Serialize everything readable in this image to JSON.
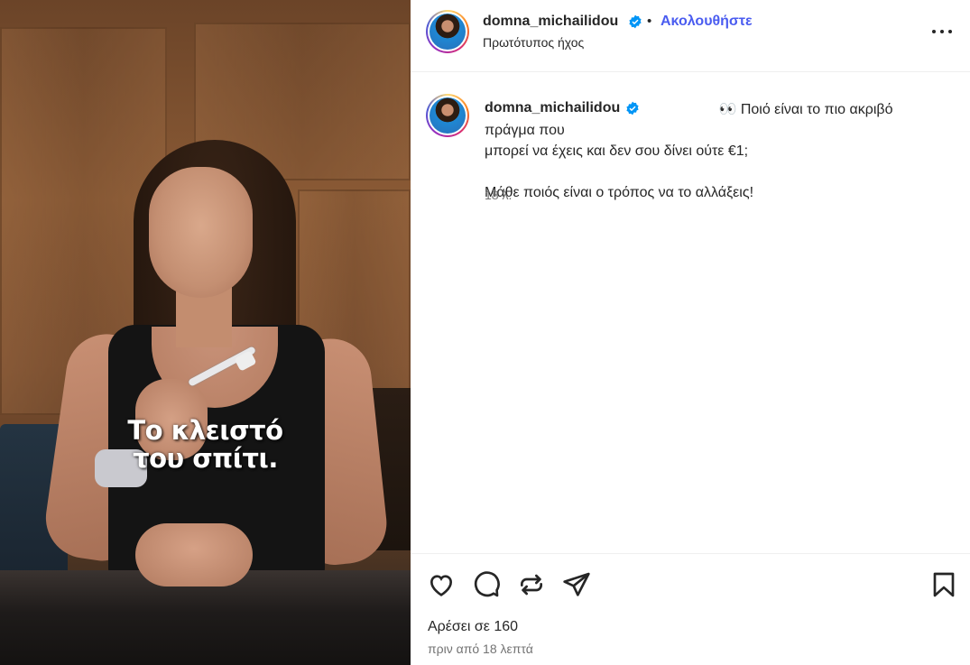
{
  "media": {
    "caption_line1": "Το κλειστό",
    "caption_line2": "του σπίτι."
  },
  "header": {
    "username": "domna_michailidou",
    "separator": "•",
    "follow_label": "Ακολουθήστε",
    "audio_label": "Πρωτότυπος ήχος"
  },
  "post": {
    "username": "domna_michailidou",
    "emoji": "👀",
    "text_line1": "Ποιό είναι το πιο ακριβό πράγμα που",
    "text_line2": "μπορεί να έχεις και δεν σου δίνει ούτε €1;",
    "text_line3": "Μάθε ποιός είναι ο τρόπος να το αλλάξεις!",
    "time_ago": "18 λ."
  },
  "footer": {
    "likes": "Αρέσει σε 160",
    "posted": "πριν από 18 λεπτά"
  },
  "colors": {
    "accent": "#4a5cf0",
    "verified": "#0095f6",
    "secondary_text": "#737373"
  },
  "icons": [
    "like-icon",
    "comment-icon",
    "share-icon",
    "send-icon",
    "save-icon",
    "more-icon",
    "verified-icon"
  ]
}
